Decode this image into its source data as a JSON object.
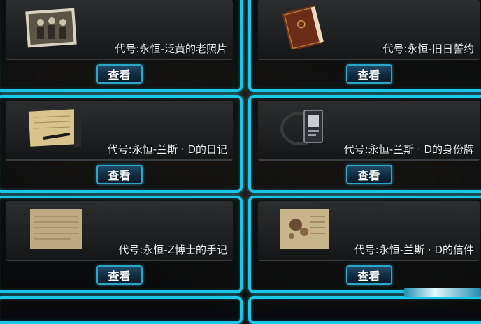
{
  "items": [
    {
      "title": "代号:永恒-泛黄的老照片",
      "button": "查看",
      "icon": "old-photo-icon"
    },
    {
      "title": "代号:永恒-旧日誓约",
      "button": "查看",
      "icon": "old-book-icon"
    },
    {
      "title": "代号:永恒-兰斯 · D的日记",
      "button": "查看",
      "icon": "diary-icon"
    },
    {
      "title": "代号:永恒-兰斯 · D的身份牌",
      "button": "查看",
      "icon": "id-badge-icon"
    },
    {
      "title": "代号:永恒-Z博士的手记",
      "button": "查看",
      "icon": "note-paper-icon"
    },
    {
      "title": "代号:永恒-兰斯 · D的信件",
      "button": "查看",
      "icon": "letter-icon"
    }
  ],
  "colors": {
    "frame": "#19c7e8",
    "button_border": "#2aa6c8",
    "text": "#f2f2f2"
  }
}
